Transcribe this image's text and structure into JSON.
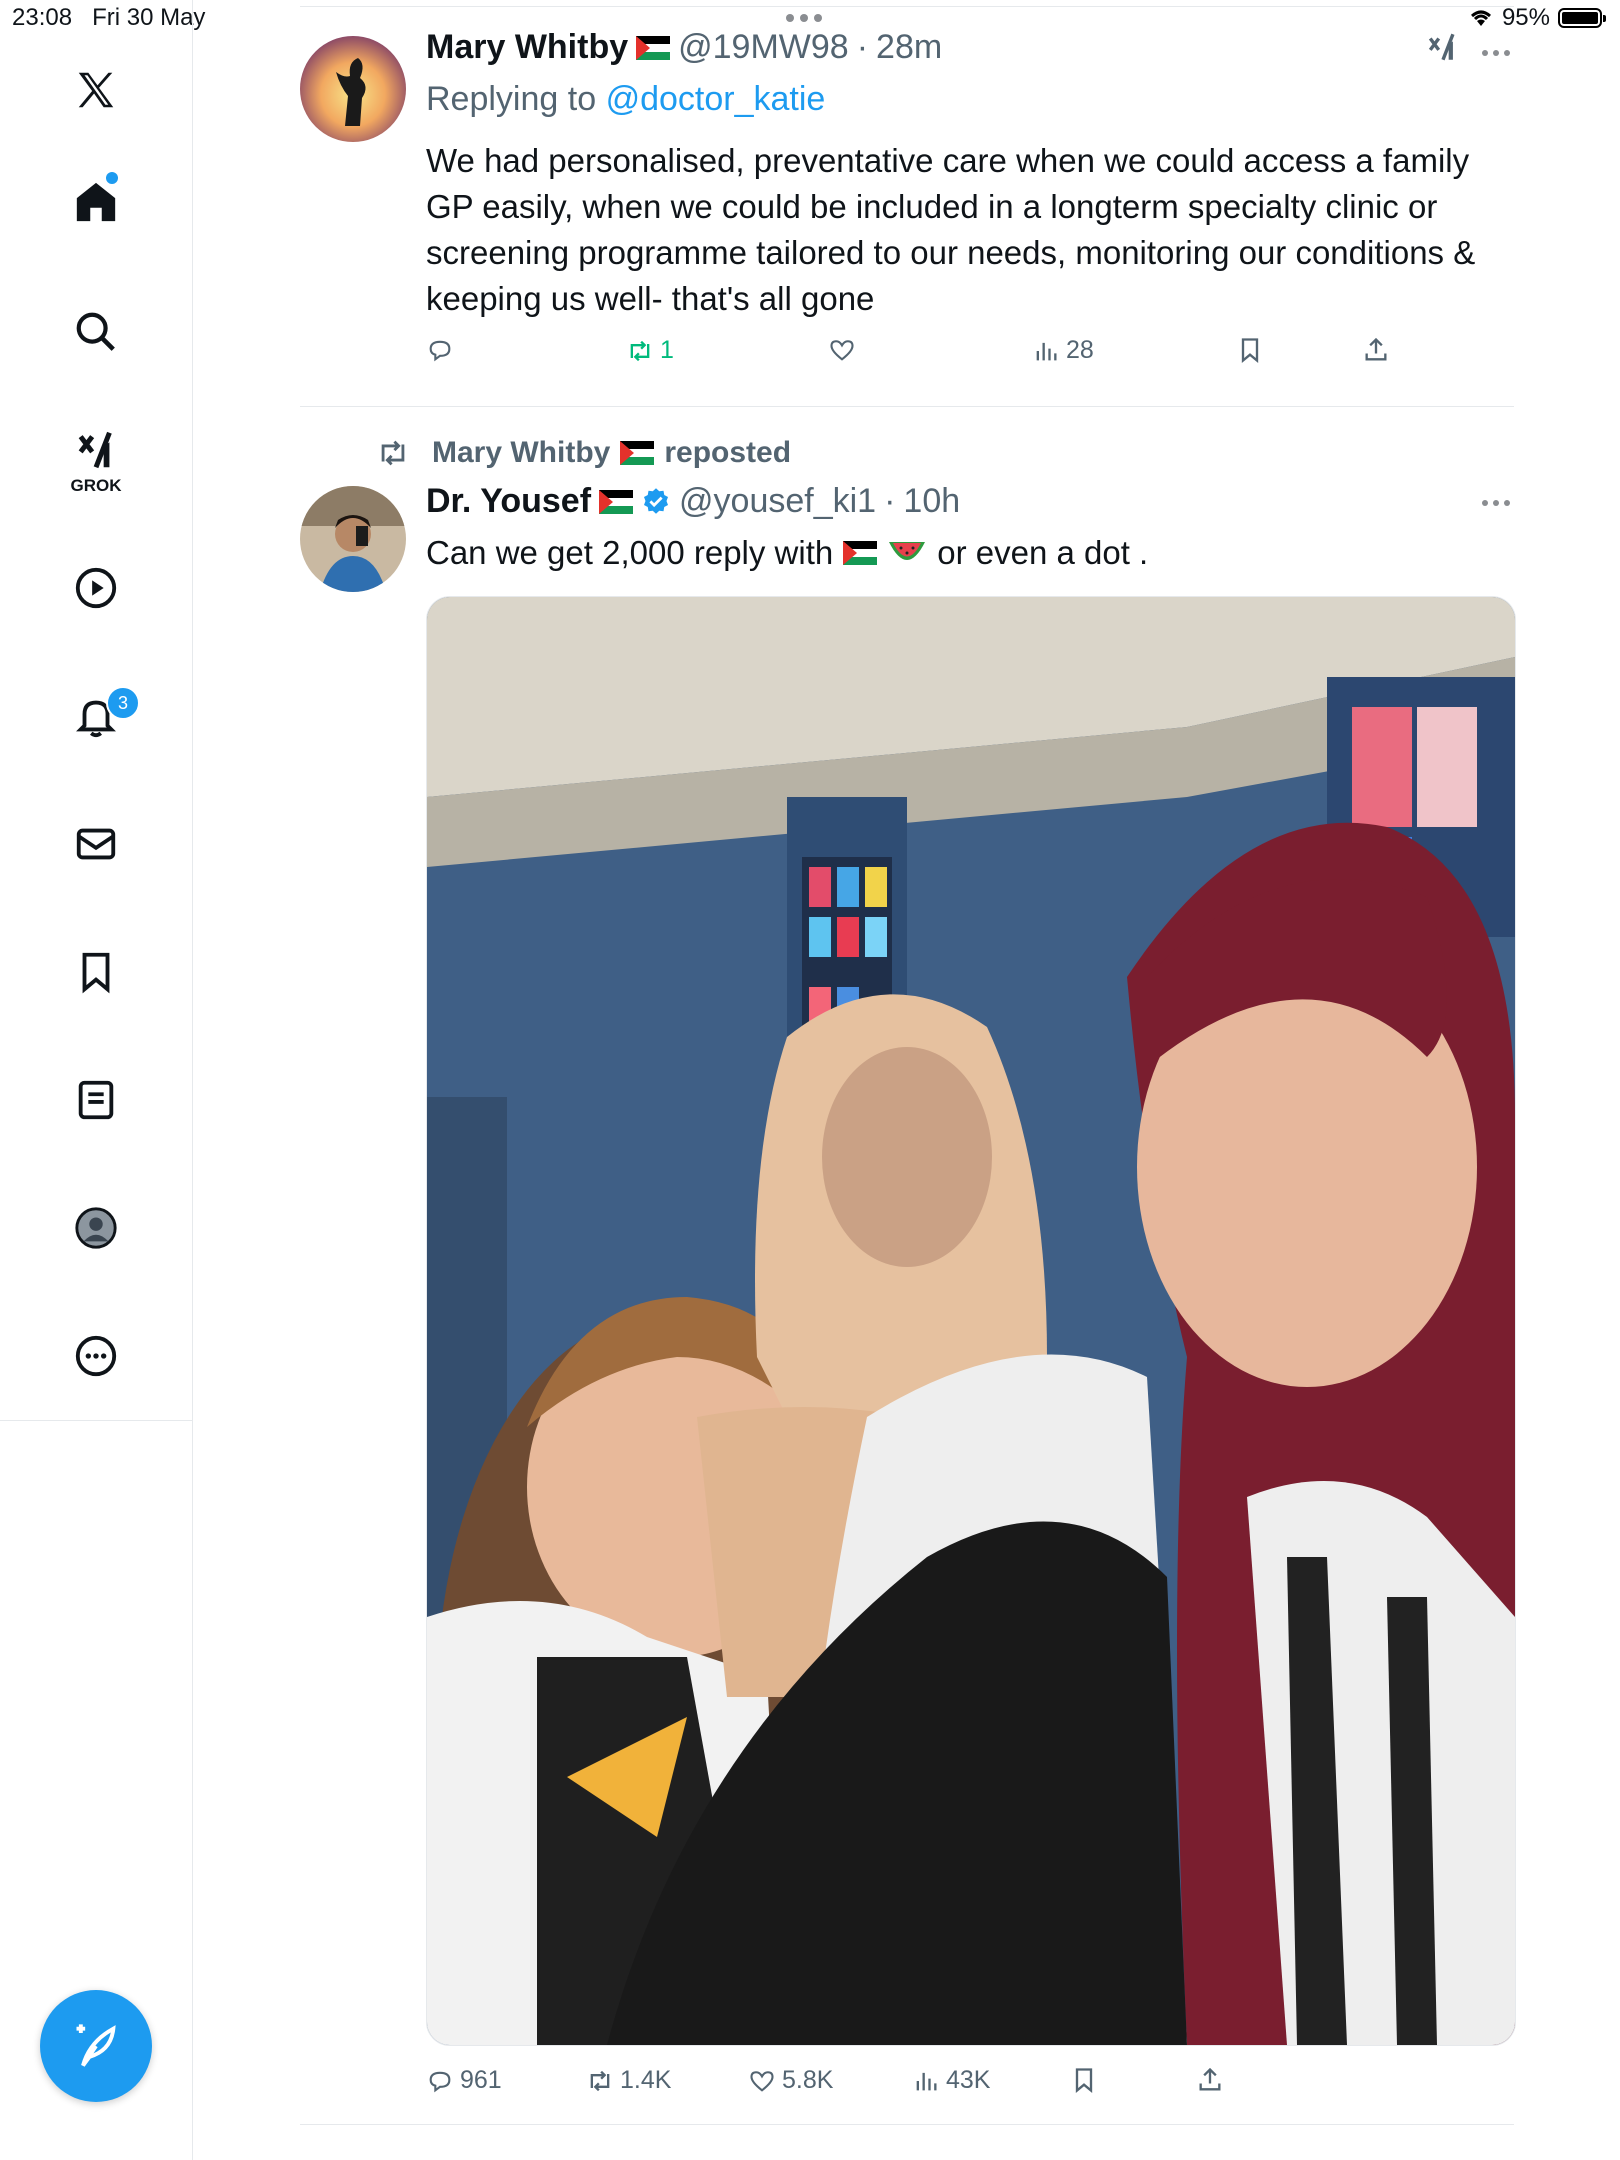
{
  "status_bar": {
    "time": "23:08",
    "date": "Fri 30 May",
    "battery": "95%"
  },
  "sidebar": {
    "grok_label": "GROK",
    "notifications_badge": "3",
    "items": [
      "home-icon",
      "search-icon",
      "grok-icon",
      "video-icon",
      "notifications-icon",
      "messages-icon",
      "bookmarks-icon",
      "lists-icon",
      "profile-icon",
      "more-icon"
    ]
  },
  "tweet1": {
    "name": "Mary Whitby",
    "handle": "@19MW98",
    "time": "28m",
    "replying_prefix": "Replying to",
    "replying_to": "@doctor_katie",
    "text": "We had personalised, preventative care when we could access a family GP easily, when we could be included in a longterm specialty clinic or screening programme tailored to our needs, monitoring our conditions & keeping us well- that's all gone",
    "reposts": "1",
    "views": "28"
  },
  "repost_header": {
    "name": "Mary Whitby",
    "label": "reposted"
  },
  "tweet2": {
    "name": "Dr. Yousef",
    "handle": "@yousef_ki1",
    "time": "10h",
    "text_part1": "Can we get 2,000 reply with",
    "text_part2": "or even a dot .",
    "replies": "961",
    "reposts": "1.4K",
    "likes": "5.8K",
    "views": "43K"
  },
  "colors": {
    "accent": "#1d9bf0",
    "repost_green": "#00ba7c",
    "muted": "#536471"
  }
}
